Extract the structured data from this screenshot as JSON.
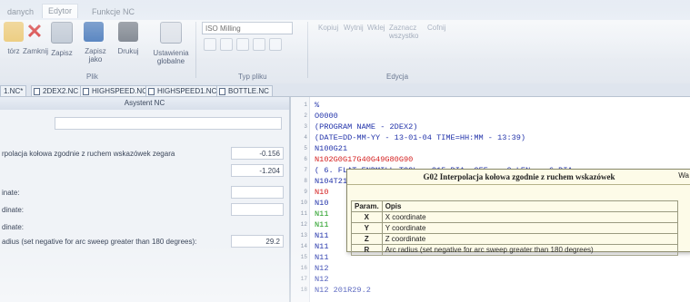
{
  "ribbon": {
    "tabs": [
      "danych",
      "Edytor",
      "Funkcje NC"
    ],
    "buttons": [
      {
        "label": "tórz",
        "icon": "open-folder-icon"
      },
      {
        "label": "Zamknij",
        "icon": "close-icon"
      },
      {
        "label": "Zapisz",
        "icon": "save-icon"
      },
      {
        "label": "Zapisz jako",
        "icon": "save-as-icon"
      },
      {
        "label": "Drukuj",
        "icon": "print-icon"
      },
      {
        "label": "Ustawienia globalne",
        "icon": "settings-icon"
      }
    ],
    "group_plik": "Plik",
    "machine_value": "ISO Milling",
    "group_typ_pliku": "Typ pliku",
    "edit_buttons": [
      "Kopiuj",
      "Wytnij",
      "Wklej",
      "Zaznacz wszystko",
      "Cofnij"
    ],
    "group_edycja": "Edycja"
  },
  "doc_tabs": [
    "1.NC*",
    "2DEX2.NC",
    "HIGHSPEED.NC",
    "HIGHSPEED1.NC",
    "BOTTLE.NC"
  ],
  "assistant": {
    "title": "Asystent NC",
    "rows": [
      {
        "label": "rpolacja kołowa zgodnie z ruchem wskazówek zegara",
        "value": "-0.156"
      },
      {
        "label": "",
        "value": "-1.204"
      },
      {
        "label": "inate:",
        "value": ""
      },
      {
        "label": "dinate:",
        "value": ""
      },
      {
        "label": "dinate:",
        "value": ""
      },
      {
        "label": "adius (set negative for arc sweep greater than 180 degrees):",
        "value": "29.2"
      }
    ]
  },
  "editor": {
    "lines": [
      {
        "n": "1",
        "text": "%",
        "color": "#2233aa"
      },
      {
        "n": "2",
        "text": "O0000",
        "color": "#2233aa"
      },
      {
        "n": "3",
        "text": "(PROGRAM NAME - 2DEX2)",
        "color": "#2233aa"
      },
      {
        "n": "4",
        "text": "(DATE=DD-MM-YY - 13-01-04 TIME=HH:MM - 13:39)",
        "color": "#2233aa"
      },
      {
        "n": "5",
        "text": "N100G21",
        "color": "#2233aa"
      },
      {
        "n": "6",
        "text": "N102G0G17G40G49G80G90",
        "color": "#d42020"
      },
      {
        "n": "7",
        "text": "( 6. FLAT ENDMILL TOOL - 215 DIA. OFF. - 0 LEN. - 6 DIA. -",
        "color": "#2233aa"
      },
      {
        "n": "8",
        "text": "N104T215M6",
        "color": "#2233aa"
      },
      {
        "n": "9",
        "text": "N10",
        "color": "#d42020"
      },
      {
        "n": "10",
        "text": "N10",
        "color": "#2233aa"
      },
      {
        "n": "11",
        "text": "N11",
        "color": "#1c9a1c"
      },
      {
        "n": "12",
        "text": "N11",
        "color": "#1c9a1c"
      },
      {
        "n": "13",
        "text": "N11",
        "color": "#2233aa"
      },
      {
        "n": "14",
        "text": "N11",
        "color": "#2233aa"
      },
      {
        "n": "15",
        "text": "N11",
        "color": "#2233aa"
      },
      {
        "n": "16",
        "text": "N12",
        "color": "#2233aa"
      },
      {
        "n": "17",
        "text": "N12",
        "color": "#2233aa"
      },
      {
        "n": "18",
        "text": "N12            201R29.2",
        "color": "#2233aa"
      }
    ]
  },
  "tooltip": {
    "title": "G02 Interpolacja kołowa zgodnie z ruchem wskazówek",
    "wa": "Wa",
    "header_param": "Param.",
    "header_opis": "Opis",
    "rows": [
      {
        "p": "X",
        "opis": "X coordinate"
      },
      {
        "p": "Y",
        "opis": "Y coordinate"
      },
      {
        "p": "Z",
        "opis": "Z coordinate"
      },
      {
        "p": "R",
        "opis": "Arc radius (set negative for arc sweep greater than 180 degrees)"
      }
    ]
  }
}
